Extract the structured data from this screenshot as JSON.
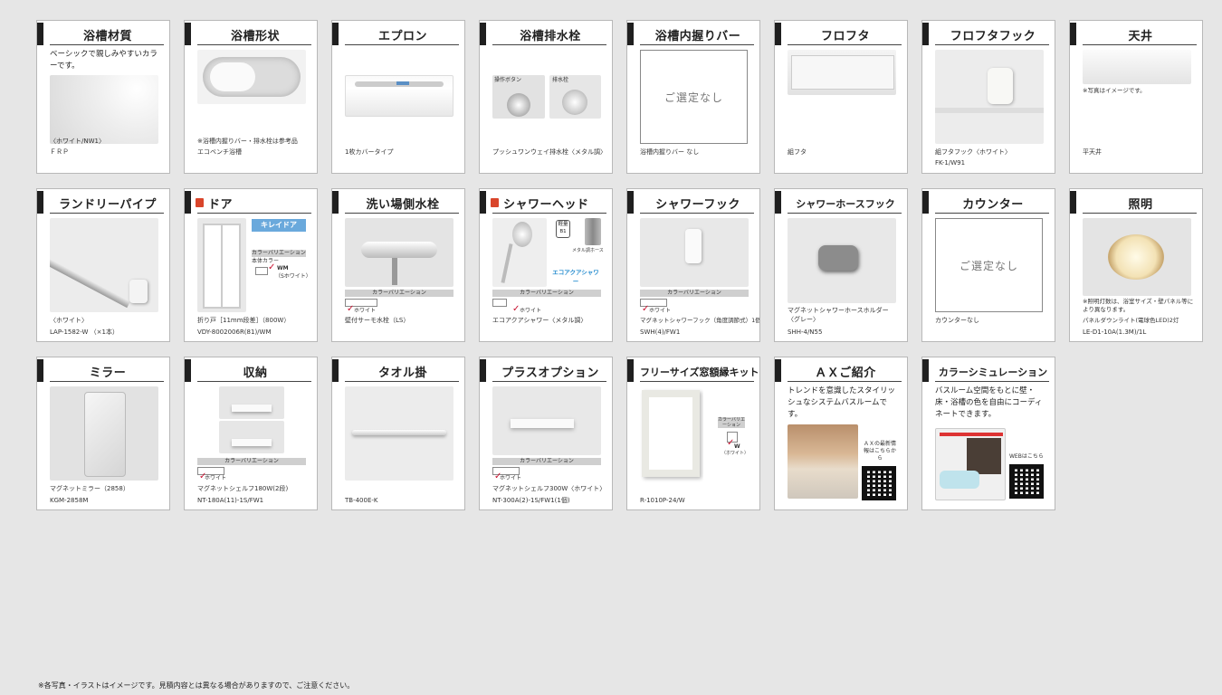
{
  "cards": {
    "c1": {
      "title": "浴槽材質",
      "desc": "ベーシックで親しみやすいカラーです。",
      "cap1": "〈ホワイト/NW1〉",
      "cap2": "ＦＲＰ"
    },
    "c2": {
      "title": "浴槽形状",
      "cap1": "※浴槽内握りバー・排水栓は参考品",
      "cap2": "エコベンチ浴槽"
    },
    "c3": {
      "title": "エプロン",
      "cap1": "1枚カバータイプ"
    },
    "c4": {
      "title": "浴槽排水栓",
      "lbl_a": "操作ボタン",
      "lbl_b": "排水栓",
      "cap1": "プッシュワンウェイ排水栓〈メタル調〉"
    },
    "c5": {
      "title": "浴槽内握りバー",
      "placeholder": "ご選定なし",
      "cap1": "浴槽内握りバー なし"
    },
    "c6": {
      "title": "フロフタ",
      "cap1": "組フタ"
    },
    "c7": {
      "title": "フロフタフック",
      "cap1": "組フタフック〈ホワイト〉",
      "cap2": "FK-1/W91"
    },
    "c8": {
      "title": "天井",
      "note": "※写真はイメージです。",
      "cap1": "平天井"
    },
    "c9": {
      "title": "ランドリーパイプ",
      "cap1": "〈ホワイト〉",
      "cap2": "LAP-1582-W （×1本）"
    },
    "c10": {
      "title": "ドア",
      "logo": "キレイドア",
      "cv_title": "カラーバリエーション",
      "cv_sub": "本体カラー",
      "cv_code": "WM",
      "cv_name": "（Sホワイト）",
      "cap1": "折り戸［11mm段差］（800W）",
      "cap2": "VDY-8002006R(81)/WM"
    },
    "c11": {
      "title": "洗い場側水栓",
      "cv": "カラーバリエーション",
      "chk": "ホワイト",
      "cap1": "壁付サーモ水栓（LS）"
    },
    "c12": {
      "title": "シャワーヘッド",
      "tag": "軽量B1",
      "tag2": "メタル調ホース",
      "eco": "エコアクアシャワー",
      "cv": "カラーバリエーション",
      "chk": "ホワイト",
      "cap1": "エコアクアシャワー〈メタル調〉"
    },
    "c13": {
      "title": "シャワーフック",
      "cv": "カラーバリエーション",
      "chk": "ホワイト",
      "cap1": "マグネットシャワーフック（角度調節式）1個",
      "cap2": "SWH(4)/FW1"
    },
    "c14": {
      "title": "シャワーホースフック",
      "cap1": "マグネットシャワーホースホルダー",
      "cap1b": "〈グレー〉",
      "cap2": "SHH-4/N55"
    },
    "c15": {
      "title": "カウンター",
      "placeholder": "ご選定なし",
      "cap1": "カウンターなし"
    },
    "c16": {
      "title": "照明",
      "note": "※照明灯数は、浴室サイズ・壁パネル等により異なります。",
      "cap1": "パネルダウンライト(電球色LED)2灯",
      "cap2": "LE-D1-10A(1.3M)/1L"
    },
    "c17": {
      "title": "ミラー",
      "cap1": "マグネットミラー（2858）",
      "cap2": "KGM-2858M"
    },
    "c18": {
      "title": "収納",
      "cv": "カラーバリエーション",
      "chk": "ホワイト",
      "cap1": "マグネットシェルフ180W(2段)",
      "cap2": "NT-180A(11)-1S/FW1"
    },
    "c19": {
      "title": "タオル掛",
      "cap1": "TB-400E-K"
    },
    "c20": {
      "title": "プラスオプション",
      "cv": "カラーバリエーション",
      "chk": "ホワイト",
      "cap1": "マグネットシェルフ300W〈ホワイト〉",
      "cap2": "NT-300A(2)-1S/FW1(1個)"
    },
    "c21": {
      "title": "フリーサイズ窓額縁キット",
      "cv_title": "カラーバリエーション",
      "cv_code": "W",
      "cv_name": "（ホワイト）",
      "cap1": "R-1010P-24/W"
    },
    "c22": {
      "title": "ＡＸご紹介",
      "desc": "トレンドを意識したスタイリッシュなシステムバスルームです。",
      "qr_label": "ＡＸの最新情報はこちらから"
    },
    "c23": {
      "title": "カラーシミュレーション",
      "desc": "バスルーム空間をもとに壁・床・浴槽の色を自由にコーディネートできます。",
      "qr_label": "WEBはこちら"
    }
  },
  "footer": "※各写真・イラストはイメージです。見積内容とは異なる場合がありますので、ご注意ください。"
}
